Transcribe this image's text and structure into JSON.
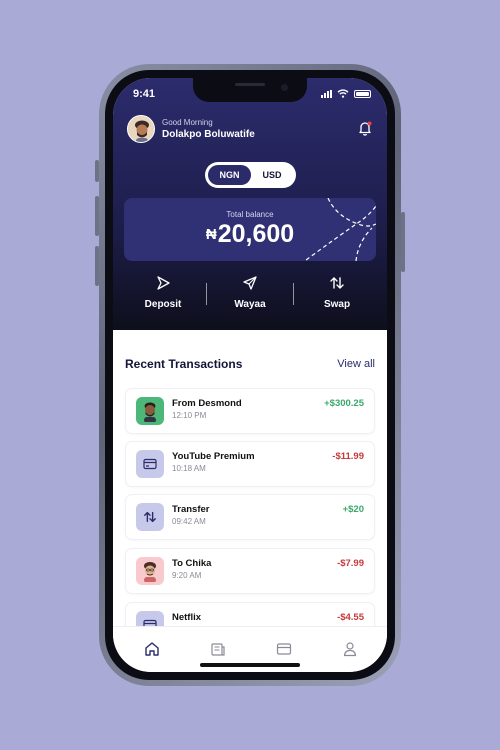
{
  "status": {
    "time": "9:41"
  },
  "header": {
    "greeting": "Good Morning",
    "user_name": "Dolakpo Boluwatife"
  },
  "currency_toggle": {
    "options": [
      "NGN",
      "USD"
    ],
    "selected": "NGN"
  },
  "balance": {
    "label": "Total balance",
    "currency_symbol": "₦",
    "amount": "20,600"
  },
  "actions": [
    {
      "label": "Deposit",
      "icon": "deposit-icon"
    },
    {
      "label": "Wayaa",
      "icon": "send-icon"
    },
    {
      "label": "Swap",
      "icon": "swap-icon"
    }
  ],
  "transactions_section": {
    "title": "Recent Transactions",
    "view_all": "View all"
  },
  "transactions": [
    {
      "name": "From Desmond",
      "time": "12:10 PM",
      "amount": "+$300.25",
      "type": "credit",
      "icon": "contact-avatar",
      "icon_bg": "#4db77a"
    },
    {
      "name": "YouTube Premium",
      "time": "10:18 AM",
      "amount": "-$11.99",
      "type": "debit",
      "icon": "card-icon",
      "icon_bg": "#c7c9ea"
    },
    {
      "name": "Transfer",
      "time": "09:42 AM",
      "amount": "+$20",
      "type": "credit",
      "icon": "swap-icon",
      "icon_bg": "#c7c9ea"
    },
    {
      "name": "To Chika",
      "time": "9:20 AM",
      "amount": "-$7.99",
      "type": "debit",
      "icon": "contact-avatar",
      "icon_bg": "#f8c9cd"
    },
    {
      "name": "Netflix",
      "time": "",
      "amount": "-$4.55",
      "type": "debit",
      "icon": "card-icon",
      "icon_bg": "#c7c9ea"
    }
  ],
  "tabbar": {
    "items": [
      "home-icon",
      "receipt-icon",
      "card-icon",
      "profile-icon"
    ],
    "active": "home-icon"
  },
  "colors": {
    "brand": "#2b2b6a",
    "credit": "#3aa86b",
    "debit": "#c73a3a",
    "background": "#aaaad6"
  }
}
